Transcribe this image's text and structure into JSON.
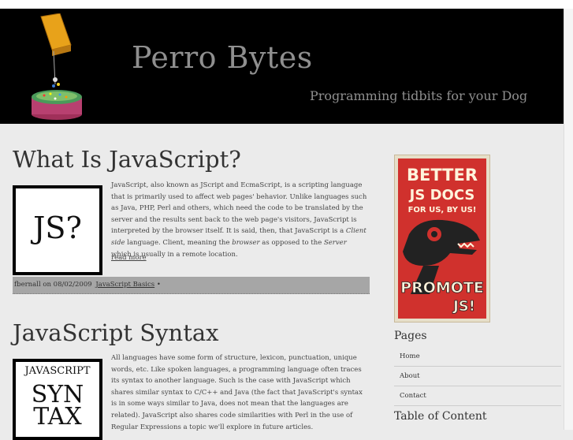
{
  "site": {
    "title": "Perro Bytes",
    "tagline": "Programming tidbits for your Dog"
  },
  "posts": [
    {
      "title": "What Is JavaScript?",
      "thumb_text": "JS?",
      "excerpt_parts": [
        "JavaScript, also known as JScript and EcmaScript, is a scripting language that is primarily used to affect web pages' behavior.  Unlike languages such as Java, PHP, Perl and others, which need the code to be translated by the server and the results sent back to the web page's visitors, JavaScript is interpreted by the browser itself. It is said, then, that JavaScript is a ",
        "Client side",
        " language. Client, meaning the ",
        "browser",
        " as opposed to the ",
        "Server",
        " which is usually in a remote location."
      ],
      "read_more": "read more",
      "meta_author_date": "fbernall on 08/02/2009",
      "meta_category": "JavaScript Basics",
      "meta_suffix": "•"
    },
    {
      "title": "JavaScript Syntax",
      "thumb_top": "JAVASCRIPT",
      "thumb_line1": "SYN",
      "thumb_line2": "TAX",
      "excerpt": "All languages have some form of structure, lexicon, punctuation, unique words, etc. Like spoken languages, a programming language often traces its syntax to another language. Such is the case with JavaScript which shares similar syntax to C/C++ and Java (the fact that JavaScript's syntax is in some ways similar to Java, does not mean that the languages are related). JavaScript also shares code similarities with Perl in the use of Regular Expressions a topic we'll explore in future articles."
    }
  ],
  "sidebar": {
    "promo": {
      "line1": "BETTER",
      "line2": "JS DOCS",
      "line3": "FOR US, BY US!",
      "line4": "PROMOTE",
      "line5": "JS!"
    },
    "pages_title": "Pages",
    "pages": [
      "Home",
      "About",
      "Contact"
    ],
    "toc_title": "Table of Content"
  },
  "colors": {
    "header_bg": "#000000",
    "header_text": "#8f8f8f",
    "body_bg": "#ebebeb",
    "meta_bar": "#a6a6a6",
    "promo_red": "#d0312d"
  }
}
